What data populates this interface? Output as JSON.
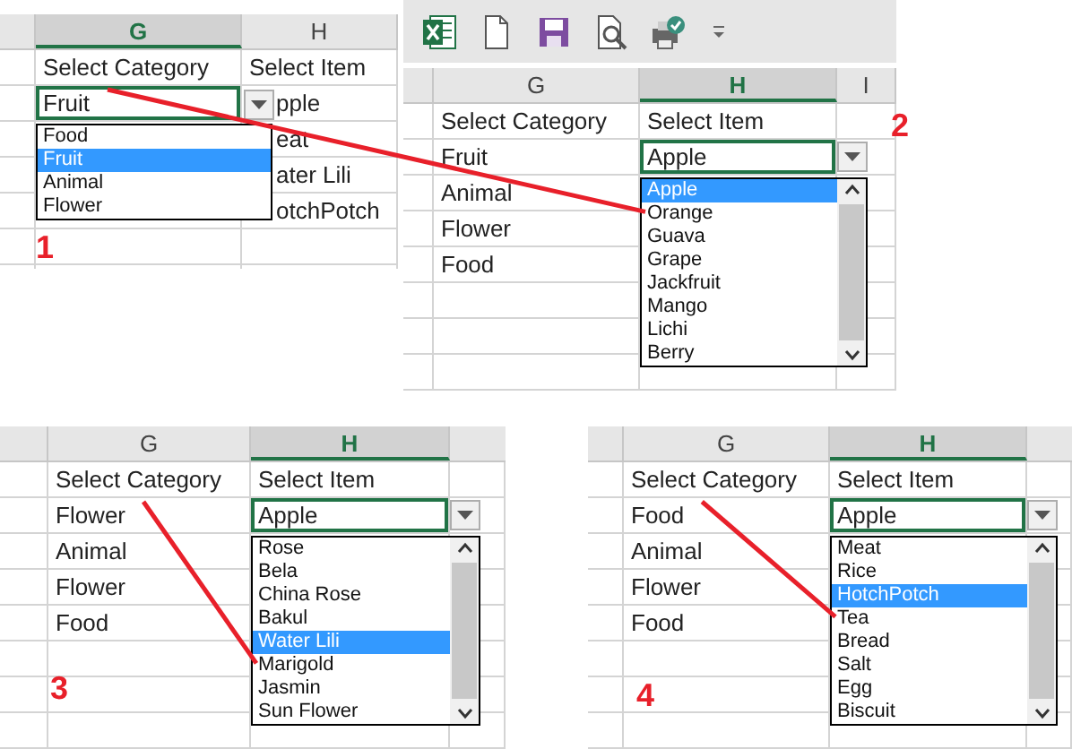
{
  "panels": [
    {
      "number": "1",
      "columns": [
        {
          "label": "G",
          "selected": true
        },
        {
          "label": "H",
          "selected": false
        }
      ],
      "rows": [
        {
          "cells": [
            {
              "text": "Select Category",
              "active": false
            },
            {
              "text": "Select Item",
              "active": false
            }
          ]
        },
        {
          "cells": [
            {
              "text": "Fruit",
              "active": true
            },
            {
              "text": "pple",
              "active": false
            }
          ]
        },
        {
          "cells": [
            null,
            {
              "text": "eat",
              "active": false
            }
          ]
        },
        {
          "cells": [
            null,
            {
              "text": "ater Lili",
              "active": false
            }
          ]
        },
        {
          "cells": [
            null,
            {
              "text": "otchPotch",
              "active": false
            }
          ]
        }
      ],
      "dropdown": {
        "scrollbar": false,
        "items": [
          {
            "label": "Food",
            "selected": false
          },
          {
            "label": "Fruit",
            "selected": true
          },
          {
            "label": "Animal",
            "selected": false
          },
          {
            "label": "Flower",
            "selected": false
          }
        ]
      }
    },
    {
      "number": "2",
      "quick_access_toolbar": true,
      "columns": [
        {
          "label": "G",
          "selected": false
        },
        {
          "label": "H",
          "selected": true
        },
        {
          "label": "I",
          "selected": false
        }
      ],
      "rows": [
        {
          "cells": [
            {
              "text": "Select Category",
              "active": false
            },
            {
              "text": "Select Item",
              "active": false
            }
          ]
        },
        {
          "cells": [
            {
              "text": "Fruit",
              "active": false
            },
            {
              "text": "Apple",
              "active": true
            }
          ]
        },
        {
          "cells": [
            {
              "text": "Animal",
              "active": false
            }
          ]
        },
        {
          "cells": [
            {
              "text": "Flower",
              "active": false
            }
          ]
        },
        {
          "cells": [
            {
              "text": "Food",
              "active": false
            }
          ]
        }
      ],
      "dropdown": {
        "scrollbar": true,
        "items": [
          {
            "label": "Apple",
            "selected": true
          },
          {
            "label": "Orange",
            "selected": false
          },
          {
            "label": "Guava",
            "selected": false
          },
          {
            "label": "Grape",
            "selected": false
          },
          {
            "label": "Jackfruit",
            "selected": false
          },
          {
            "label": "Mango",
            "selected": false
          },
          {
            "label": "Lichi",
            "selected": false
          },
          {
            "label": "Berry",
            "selected": false
          }
        ]
      }
    },
    {
      "number": "3",
      "columns": [
        {
          "label": "G",
          "selected": false
        },
        {
          "label": "H",
          "selected": true
        }
      ],
      "rows": [
        {
          "cells": [
            {
              "text": "Select Category",
              "active": false
            },
            {
              "text": "Select Item",
              "active": false
            }
          ]
        },
        {
          "cells": [
            {
              "text": "Flower",
              "active": false
            },
            {
              "text": "Apple",
              "active": true
            }
          ]
        },
        {
          "cells": [
            {
              "text": "Animal",
              "active": false
            }
          ]
        },
        {
          "cells": [
            {
              "text": "Flower",
              "active": false
            }
          ]
        },
        {
          "cells": [
            {
              "text": "Food",
              "active": false
            }
          ]
        }
      ],
      "dropdown": {
        "scrollbar": true,
        "items": [
          {
            "label": "Rose",
            "selected": false
          },
          {
            "label": "Bela",
            "selected": false
          },
          {
            "label": "China Rose",
            "selected": false
          },
          {
            "label": "Bakul",
            "selected": false
          },
          {
            "label": "Water Lili",
            "selected": true
          },
          {
            "label": "Marigold",
            "selected": false
          },
          {
            "label": "Jasmin",
            "selected": false
          },
          {
            "label": "Sun Flower",
            "selected": false
          }
        ]
      }
    },
    {
      "number": "4",
      "columns": [
        {
          "label": "G",
          "selected": false
        },
        {
          "label": "H",
          "selected": true
        }
      ],
      "rows": [
        {
          "cells": [
            {
              "text": "Select Category",
              "active": false
            },
            {
              "text": "Select Item",
              "active": false
            }
          ]
        },
        {
          "cells": [
            {
              "text": "Food",
              "active": false
            },
            {
              "text": "Apple",
              "active": true
            }
          ]
        },
        {
          "cells": [
            {
              "text": "Animal",
              "active": false
            }
          ]
        },
        {
          "cells": [
            {
              "text": "Flower",
              "active": false
            }
          ]
        },
        {
          "cells": [
            {
              "text": "Food",
              "active": false
            }
          ]
        }
      ],
      "dropdown": {
        "scrollbar": true,
        "items": [
          {
            "label": "Meat",
            "selected": false
          },
          {
            "label": "Rice",
            "selected": false
          },
          {
            "label": "HotchPotch",
            "selected": true
          },
          {
            "label": "Tea",
            "selected": false
          },
          {
            "label": "Bread",
            "selected": false
          },
          {
            "label": "Salt",
            "selected": false
          },
          {
            "label": "Egg",
            "selected": false
          },
          {
            "label": "Biscuit",
            "selected": false
          }
        ]
      }
    }
  ]
}
